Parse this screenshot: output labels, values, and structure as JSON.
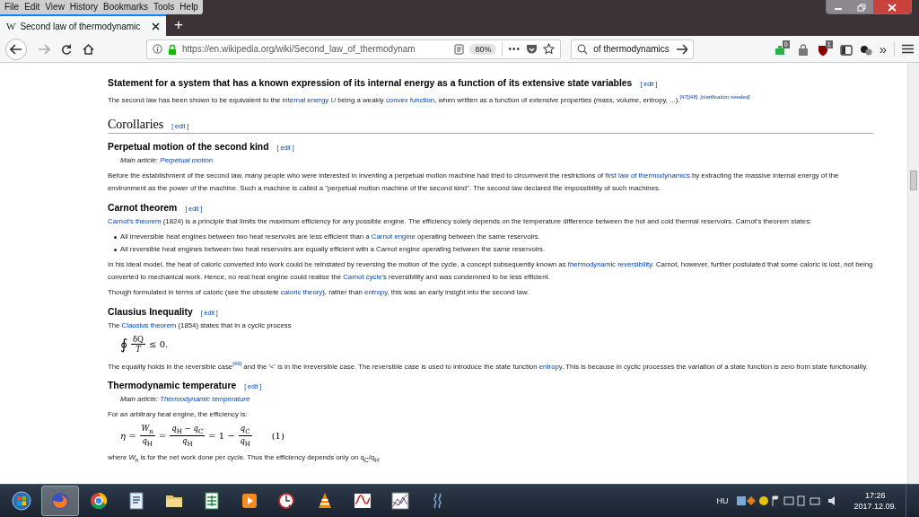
{
  "menu": [
    "File",
    "Edit",
    "View",
    "History",
    "Bookmarks",
    "Tools",
    "Help"
  ],
  "tabs": [
    {
      "favicon": "W",
      "title": "Second law of thermodynamic",
      "selected": true
    }
  ],
  "new_tab": "+",
  "url": "https://en.wikipedia.org/wiki/Second_law_of_thermodynam",
  "zoom": "80%",
  "page_actions": "•••",
  "search": {
    "value": "of thermodynamics"
  },
  "extensions": [
    {
      "kind": "puzzle",
      "badge": "0"
    },
    {
      "kind": "bag"
    },
    {
      "kind": "shield",
      "badge": "1"
    },
    {
      "kind": "sidebar"
    },
    {
      "kind": "balls"
    }
  ],
  "overflow": "»",
  "article": [
    {
      "kind": "h3",
      "text": "Statement for a system that has a known expression of its internal energy as a function of its extensive state variables",
      "edit": "[ edit ]"
    },
    {
      "kind": "p",
      "segments": [
        {
          "kind": "text",
          "text": "The second law has been shown to be equivalent to the "
        },
        {
          "kind": "link",
          "text": "internal energy *U*"
        },
        {
          "kind": "text",
          "text": " being a weakly "
        },
        {
          "kind": "link",
          "text": "convex function"
        },
        {
          "kind": "text",
          "text": ", when written as a function of extensive properties (mass, volume, entropy, ...)."
        },
        {
          "kind": "ref",
          "text": "[47][48]"
        },
        {
          "kind": "ref",
          "text": "*[clarification needed]*"
        }
      ]
    },
    {
      "kind": "h2",
      "text": "Corollaries",
      "edit": "[ edit ]"
    },
    {
      "kind": "h3",
      "text": "Perpetual motion of the second kind",
      "edit": "[ edit ]"
    },
    {
      "kind": "hatnote",
      "segments": [
        {
          "kind": "text",
          "text": "Main article: "
        },
        {
          "kind": "link",
          "text": "Perpetual motion"
        }
      ]
    },
    {
      "kind": "p",
      "segments": [
        {
          "kind": "text",
          "text": "Before the establishment of the second law, many people who were interested in inventing a perpetual motion machine had tried to circumvent the restrictions of "
        },
        {
          "kind": "link",
          "text": "first law of thermodynamics"
        },
        {
          "kind": "text",
          "text": " by extracting the massive internal energy of the environment as the power of the machine. Such a machine is called a \"perpetual motion machine of the second kind\". The second law declared the impossibility of such machines."
        }
      ]
    },
    {
      "kind": "h3",
      "text": "Carnot theorem",
      "edit": "[ edit ]"
    },
    {
      "kind": "p",
      "segments": [
        {
          "kind": "link",
          "text": "Carnot's theorem"
        },
        {
          "kind": "text",
          "text": " (1824) is a principle that limits the maximum efficiency for any possible engine. The efficiency solely depends on the temperature difference between the hot and cold thermal reservoirs. Carnot's theorem states:"
        }
      ]
    },
    {
      "kind": "bullets",
      "items": [
        [
          {
            "kind": "text",
            "text": "All irreversible heat engines between two heat reservoirs are less efficient than a "
          },
          {
            "kind": "link",
            "text": "Carnot engine"
          },
          {
            "kind": "text",
            "text": " operating between the same reservoirs."
          }
        ],
        [
          {
            "kind": "text",
            "text": "All reversible heat engines between two heat reservoirs are equally efficient with a Carnot engine operating between the same reservoirs."
          }
        ]
      ]
    },
    {
      "kind": "p",
      "segments": [
        {
          "kind": "text",
          "text": "In his ideal model, the heat of caloric converted into work could be reinstated by reversing the motion of the cycle, a concept subsequently known as "
        },
        {
          "kind": "link",
          "text": "thermodynamic reversibility"
        },
        {
          "kind": "text",
          "text": ". Carnot, however, further postulated that some caloric is lost, not being converted to mechanical work. Hence, no real heat engine could realise the "
        },
        {
          "kind": "link",
          "text": "Carnot cycle"
        },
        {
          "kind": "text",
          "text": "'s reversibility and was condemned to be less efficient."
        }
      ]
    },
    {
      "kind": "p",
      "segments": [
        {
          "kind": "text",
          "text": "Though formulated in terms of caloric (see the obsolete "
        },
        {
          "kind": "link",
          "text": "caloric theory"
        },
        {
          "kind": "text",
          "text": "), rather than "
        },
        {
          "kind": "link",
          "text": "entropy"
        },
        {
          "kind": "text",
          "text": ", this was an early insight into the second law."
        }
      ]
    },
    {
      "kind": "h3",
      "text": "Clausius Inequality",
      "edit": "[ edit ]"
    },
    {
      "kind": "p",
      "segments": [
        {
          "kind": "text",
          "text": "The "
        },
        {
          "kind": "link",
          "text": "Clausius theorem"
        },
        {
          "kind": "text",
          "text": " (1854) states that in a cyclic process"
        }
      ]
    },
    {
      "kind": "formula",
      "parts": [
        {
          "kind": "sym",
          "text": "∮"
        },
        {
          "kind": "frac",
          "num": "δQ",
          "den": "*T*"
        },
        {
          "kind": "sym",
          "text": "≤ 0."
        }
      ]
    },
    {
      "kind": "p",
      "segments": [
        {
          "kind": "text",
          "text": "The equality holds in the reversible case"
        },
        {
          "kind": "ref",
          "text": "[49]"
        },
        {
          "kind": "text",
          "text": " and the '<' is in the irreversible case. The reversible case is used to introduce the state function "
        },
        {
          "kind": "link",
          "text": "entropy"
        },
        {
          "kind": "text",
          "text": ". This is because in cyclic processes the variation of a state function is zero from state functionality."
        }
      ]
    },
    {
      "kind": "h3",
      "text": "Thermodynamic temperature",
      "edit": "[ edit ]"
    },
    {
      "kind": "hatnote",
      "segments": [
        {
          "kind": "text",
          "text": "Main article: "
        },
        {
          "kind": "link",
          "text": "Thermodynamic temperature"
        }
      ]
    },
    {
      "kind": "p",
      "segments": [
        {
          "kind": "text",
          "text": "For an arbitrary heat engine, the efficiency is:"
        }
      ]
    },
    {
      "kind": "formula",
      "parts": [
        {
          "kind": "sym",
          "text": "*η* ="
        },
        {
          "kind": "frac",
          "num": "*W*$_{n}$",
          "den": "*q*$_{H}$"
        },
        {
          "kind": "sym",
          "text": "="
        },
        {
          "kind": "frac",
          "num": "*q*$_{H}$ − *q*$_{C}$",
          "den": "*q*$_{H}$"
        },
        {
          "kind": "sym",
          "text": "= 1 −"
        },
        {
          "kind": "frac",
          "num": "*q*$_{C}$",
          "den": "*q*$_{H}$"
        },
        {
          "kind": "number",
          "text": "(1)"
        }
      ]
    },
    {
      "kind": "p",
      "segments": [
        {
          "kind": "text",
          "text": "where *W*$_{n}$ is for the net work done per cycle. Thus the efficiency depends only on q$_{C}$/q$_{H}$."
        }
      ]
    }
  ],
  "taskbar": [
    {
      "kind": "fox",
      "selected": true
    },
    {
      "kind": "ring",
      "selected": false
    },
    {
      "kind": "doc",
      "selected": false
    },
    {
      "kind": "folder",
      "selected": false
    },
    {
      "kind": "sheet",
      "selected": false
    },
    {
      "kind": "play",
      "selected": false
    },
    {
      "kind": "clock",
      "selected": false
    },
    {
      "kind": "cone",
      "selected": false
    },
    {
      "kind": "wave",
      "selected": false
    },
    {
      "kind": "chart",
      "selected": false
    },
    {
      "kind": "steam",
      "selected": false
    }
  ],
  "tray": {
    "language": "HU",
    "time": "17:26",
    "date": "2017.12.09."
  }
}
